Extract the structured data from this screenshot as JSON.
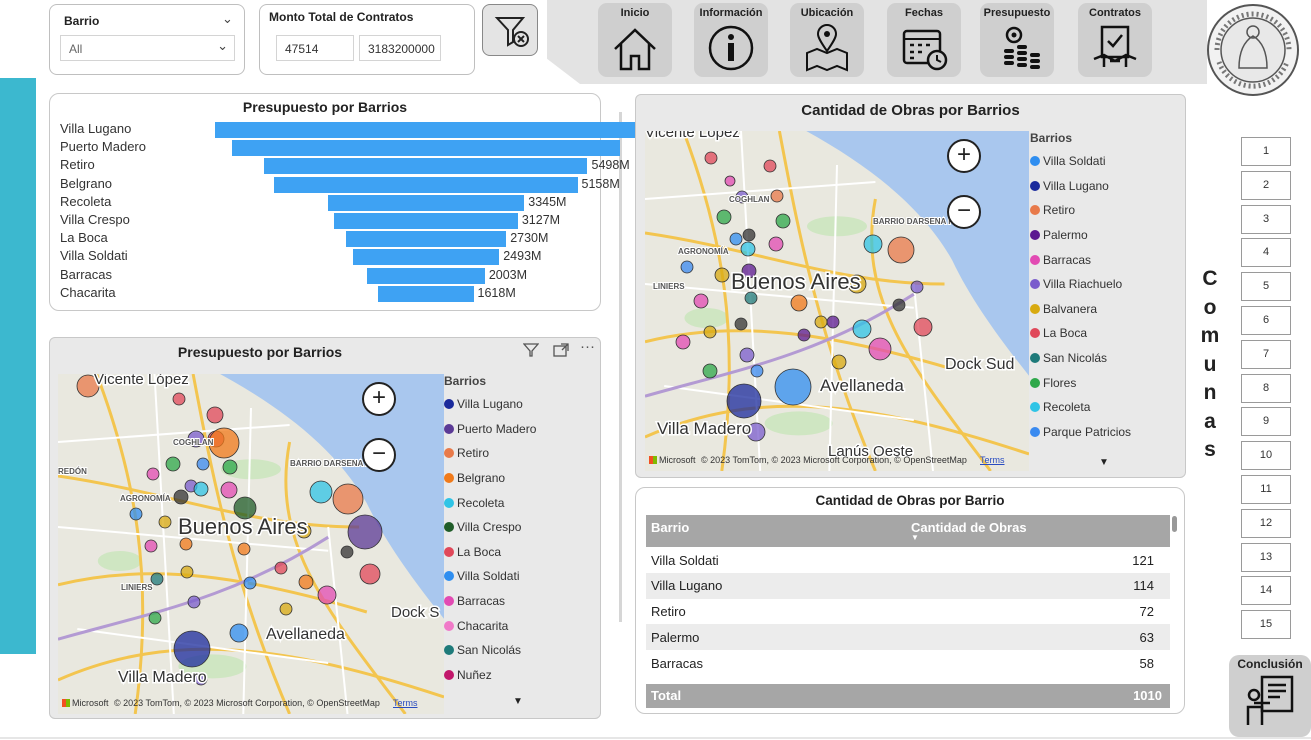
{
  "filters": {
    "barrio": {
      "title": "Barrio",
      "value": "All"
    },
    "monto": {
      "title": "Monto Total de Contratos",
      "min": "47514",
      "max": "3183200000"
    }
  },
  "nav": {
    "inicio": "Inicio",
    "informacion": "Información",
    "ubicacion": "Ubicación",
    "fechas": "Fechas",
    "presupuesto": "Presupuesto",
    "contratos": "Contratos"
  },
  "bar_chart": {
    "title": "Presupuesto por Barrios",
    "bars": [
      {
        "label": "Villa Lugano",
        "value_text": ""
      },
      {
        "label": "Puerto Madero",
        "value_text": ""
      },
      {
        "label": "Retiro",
        "value_text": "5498M"
      },
      {
        "label": "Belgrano",
        "value_text": "5158M"
      },
      {
        "label": "Recoleta",
        "value_text": "3345M"
      },
      {
        "label": "Villa Crespo",
        "value_text": "3127M"
      },
      {
        "label": "La Boca",
        "value_text": "2730M"
      },
      {
        "label": "Villa Soldati",
        "value_text": "2493M"
      },
      {
        "label": "Barracas",
        "value_text": "2003M"
      },
      {
        "label": "Chacarita",
        "value_text": "1618M"
      }
    ]
  },
  "chart_data": {
    "type": "bar",
    "title": "Presupuesto por Barrios",
    "categories": [
      "Villa Lugano",
      "Puerto Madero",
      "Retiro",
      "Belgrano",
      "Recoleta",
      "Villa Crespo",
      "La Boca",
      "Villa Soldati",
      "Barracas",
      "Chacarita"
    ],
    "values": [
      7200,
      6600,
      5498,
      5158,
      3345,
      3127,
      2730,
      2493,
      2003,
      1618
    ],
    "unit": "M"
  },
  "map_left": {
    "title": "Presupuesto por Barrios",
    "legend_title": "Barrios",
    "legend": [
      {
        "name": "Villa Lugano",
        "color": "#1a2a9c"
      },
      {
        "name": "Puerto Madero",
        "color": "#5b3a96"
      },
      {
        "name": "Retiro",
        "color": "#e87a4a"
      },
      {
        "name": "Belgrano",
        "color": "#f07a1a"
      },
      {
        "name": "Recoleta",
        "color": "#2fc4e6"
      },
      {
        "name": "Villa Crespo",
        "color": "#1f5c28"
      },
      {
        "name": "La Boca",
        "color": "#e0485a"
      },
      {
        "name": "Villa Soldati",
        "color": "#2f8ef0"
      },
      {
        "name": "Barracas",
        "color": "#e24bb3"
      },
      {
        "name": "Chacarita",
        "color": "#f07ac8"
      },
      {
        "name": "San Nicolás",
        "color": "#1e7a7a"
      },
      {
        "name": "Nuñez",
        "color": "#c2186b"
      }
    ],
    "labels": {
      "city": "Buenos Aires",
      "north": "Vicente López",
      "south": "Avellaneda",
      "sw": "Villa Madero",
      "dock": "Dock S",
      "darsena": "BARRIO DARSENA F",
      "cog": "COGHLAN",
      "agro": "AGRONOMÍA",
      "redon": "REDÓN",
      "liniers": "LINIERS"
    },
    "attribution": "© 2023 TomTom, © 2023 Microsoft Corporation, © OpenStreetMap",
    "terms": "Terms",
    "ms": "Microsoft"
  },
  "map_right": {
    "title": "Cantidad de Obras por Barrios",
    "legend_title": "Barrios",
    "legend": [
      {
        "name": "Villa Soldati",
        "color": "#2f8ef0"
      },
      {
        "name": "Villa Lugano",
        "color": "#1a2a9c"
      },
      {
        "name": "Retiro",
        "color": "#e87a4a"
      },
      {
        "name": "Palermo",
        "color": "#5b1890"
      },
      {
        "name": "Barracas",
        "color": "#e24bb3"
      },
      {
        "name": "Villa Riachuelo",
        "color": "#7a5ccc"
      },
      {
        "name": "Balvanera",
        "color": "#d8aa10"
      },
      {
        "name": "La Boca",
        "color": "#e0485a"
      },
      {
        "name": "San Nicolás",
        "color": "#1e7a7a"
      },
      {
        "name": "Flores",
        "color": "#2ea84a"
      },
      {
        "name": "Recoleta",
        "color": "#2fc4e6"
      },
      {
        "name": "Parque Patricios",
        "color": "#3a8af0"
      }
    ],
    "labels": {
      "city": "Buenos Aires",
      "north": "Vicente López",
      "south": "Avellaneda",
      "sw": "Villa Madero",
      "dock": "Dock Sud",
      "lanus": "Lanús Oeste",
      "darsena": "BARRIO DARSENA F",
      "cog": "COGHLAN",
      "agro": "AGRONOMÍA",
      "liniers": "LINIERS"
    },
    "attribution": "© 2023 TomTom, © 2023 Microsoft Corporation, © OpenStreetMap",
    "terms": "Terms",
    "ms": "Microsoft"
  },
  "table": {
    "title": "Cantidad de Obras por Barrio",
    "col1": "Barrio",
    "col2": "Cantidad de Obras",
    "rows": [
      {
        "barrio": "Villa Soldati",
        "cantidad": "121"
      },
      {
        "barrio": "Villa Lugano",
        "cantidad": "114"
      },
      {
        "barrio": "Retiro",
        "cantidad": "72"
      },
      {
        "barrio": "Palermo",
        "cantidad": "63"
      },
      {
        "barrio": "Barracas",
        "cantidad": "58"
      }
    ],
    "total_label": "Total",
    "total_value": "1010"
  },
  "comunas": {
    "title": "Comunas",
    "letters": [
      "C",
      "o",
      "m",
      "u",
      "n",
      "a",
      "s"
    ],
    "items": [
      "1",
      "2",
      "3",
      "4",
      "5",
      "6",
      "7",
      "8",
      "9",
      "10",
      "11",
      "12",
      "13",
      "14",
      "15"
    ]
  },
  "conclusion": {
    "label": "Conclusión"
  },
  "colors": {
    "accent": "#3cb8cf",
    "bar": "#3ea2f3",
    "table_header": "#a6a6a6"
  }
}
